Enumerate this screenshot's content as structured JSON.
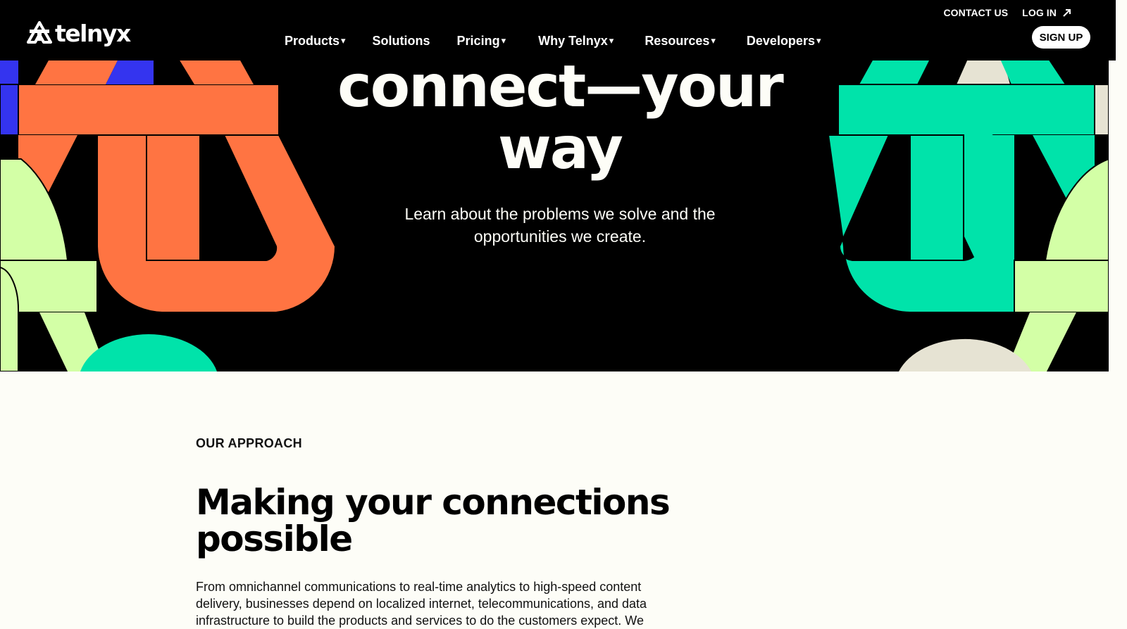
{
  "brand": {
    "name": "telnyx"
  },
  "topbar": {
    "contact": "CONTACT US",
    "login": "LOG IN",
    "signup": "SIGN UP"
  },
  "nav": {
    "items": [
      {
        "label": "Products",
        "has_dropdown": true
      },
      {
        "label": "Solutions",
        "has_dropdown": false
      },
      {
        "label": "Pricing",
        "has_dropdown": true
      },
      {
        "label": "Why Telnyx",
        "has_dropdown": true
      },
      {
        "label": "Resources",
        "has_dropdown": true
      },
      {
        "label": "Developers",
        "has_dropdown": true
      }
    ],
    "caret": "▾"
  },
  "hero": {
    "title_line1": "connect—your",
    "title_line2": "way",
    "subtitle": "Learn about the problems we solve and the opportunities we create."
  },
  "approach": {
    "eyebrow": "OUR APPROACH",
    "title": "Making your connections possible",
    "body": "From omnichannel communications to real-time analytics to high-speed content delivery, businesses depend on localized internet, telecommunications, and data infrastructure to build the products and services to do the customers expect. We"
  },
  "colors": {
    "orange": "#ff7442",
    "green": "#00e3aa",
    "lime": "#d3ffa6",
    "blue": "#3434ef",
    "cream": "#e6e3d3",
    "bg": "#fdfdf7"
  },
  "icons": {
    "external_link": "arrow-up-right-icon",
    "logo": "telnyx-logo-icon"
  }
}
